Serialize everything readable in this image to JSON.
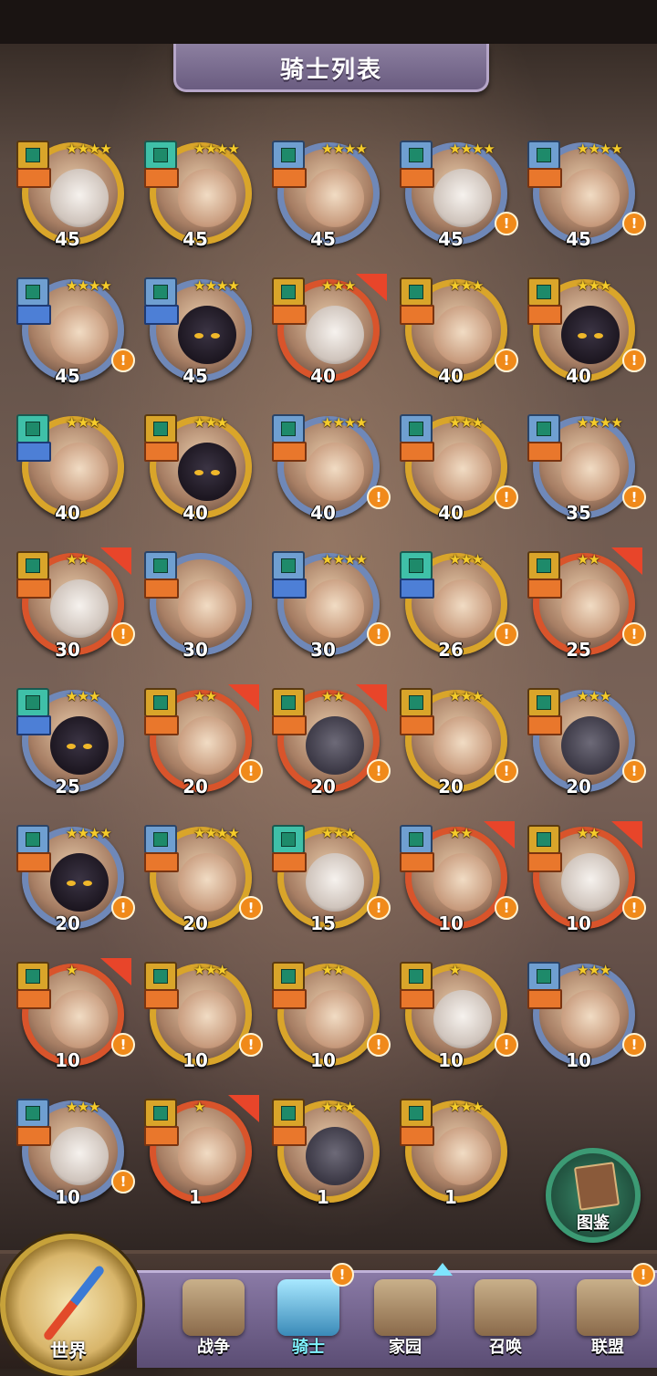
{
  "header": {
    "title": "骑士列表"
  },
  "knights": [
    {
      "level": "45",
      "stars": "★★★★",
      "ring": "",
      "badge": "",
      "role": "",
      "face": "cat",
      "alert": false,
      "corner": false
    },
    {
      "level": "45",
      "stars": "★★★★",
      "ring": "",
      "badge": "green",
      "role": "",
      "face": "",
      "alert": false,
      "corner": false
    },
    {
      "level": "45",
      "stars": "★★★★",
      "ring": "blue",
      "badge": "blue",
      "role": "",
      "face": "",
      "alert": false,
      "corner": false
    },
    {
      "level": "45",
      "stars": "★★★★",
      "ring": "blue",
      "badge": "blue",
      "role": "",
      "face": "cat",
      "alert": true,
      "corner": false
    },
    {
      "level": "45",
      "stars": "★★★★",
      "ring": "blue",
      "badge": "blue",
      "role": "",
      "face": "",
      "alert": true,
      "corner": false
    },
    {
      "level": "45",
      "stars": "★★★★",
      "ring": "blue",
      "badge": "blue",
      "role": "blue",
      "face": "",
      "alert": true,
      "corner": false
    },
    {
      "level": "45",
      "stars": "★★★★",
      "ring": "blue",
      "badge": "blue",
      "role": "blue",
      "face": "dark",
      "alert": false,
      "corner": false
    },
    {
      "level": "40",
      "stars": "★★★",
      "ring": "red",
      "badge": "",
      "role": "",
      "face": "cat",
      "alert": false,
      "corner": true
    },
    {
      "level": "40",
      "stars": "★★★",
      "ring": "",
      "badge": "",
      "role": "",
      "face": "",
      "alert": true,
      "corner": false
    },
    {
      "level": "40",
      "stars": "★★★",
      "ring": "",
      "badge": "",
      "role": "",
      "face": "dark",
      "alert": true,
      "corner": false
    },
    {
      "level": "40",
      "stars": "★★★",
      "ring": "",
      "badge": "green",
      "role": "blue",
      "face": "",
      "alert": false,
      "corner": false
    },
    {
      "level": "40",
      "stars": "★★★",
      "ring": "",
      "badge": "",
      "role": "",
      "face": "dark",
      "alert": false,
      "corner": false
    },
    {
      "level": "40",
      "stars": "★★★★",
      "ring": "blue",
      "badge": "blue",
      "role": "",
      "face": "",
      "alert": true,
      "corner": false
    },
    {
      "level": "40",
      "stars": "★★★",
      "ring": "",
      "badge": "blue",
      "role": "",
      "face": "",
      "alert": true,
      "corner": false
    },
    {
      "level": "35",
      "stars": "★★★★",
      "ring": "blue",
      "badge": "blue",
      "role": "",
      "face": "",
      "alert": true,
      "corner": false
    },
    {
      "level": "30",
      "stars": "★★",
      "ring": "red",
      "badge": "",
      "role": "",
      "face": "cat",
      "alert": true,
      "corner": true
    },
    {
      "level": "30",
      "stars": "",
      "ring": "blue",
      "badge": "blue",
      "role": "",
      "face": "",
      "alert": false,
      "corner": false
    },
    {
      "level": "30",
      "stars": "★★★★",
      "ring": "blue",
      "badge": "blue",
      "role": "blue",
      "face": "",
      "alert": true,
      "corner": false
    },
    {
      "level": "26",
      "stars": "★★★",
      "ring": "",
      "badge": "green",
      "role": "blue",
      "face": "",
      "alert": true,
      "corner": false
    },
    {
      "level": "25",
      "stars": "★★",
      "ring": "red",
      "badge": "",
      "role": "",
      "face": "",
      "alert": true,
      "corner": true
    },
    {
      "level": "25",
      "stars": "★★★",
      "ring": "blue",
      "badge": "green",
      "role": "blue",
      "face": "dark",
      "alert": false,
      "corner": false
    },
    {
      "level": "20",
      "stars": "★★",
      "ring": "red",
      "badge": "",
      "role": "",
      "face": "",
      "alert": true,
      "corner": true
    },
    {
      "level": "20",
      "stars": "★★",
      "ring": "red",
      "badge": "",
      "role": "",
      "face": "beast",
      "alert": true,
      "corner": true
    },
    {
      "level": "20",
      "stars": "★★★",
      "ring": "",
      "badge": "",
      "role": "",
      "face": "",
      "alert": true,
      "corner": false
    },
    {
      "level": "20",
      "stars": "★★★",
      "ring": "blue",
      "badge": "",
      "role": "",
      "face": "beast",
      "alert": true,
      "corner": false
    },
    {
      "level": "20",
      "stars": "★★★★",
      "ring": "blue",
      "badge": "blue",
      "role": "",
      "face": "dark",
      "alert": true,
      "corner": false
    },
    {
      "level": "20",
      "stars": "★★★★",
      "ring": "",
      "badge": "blue",
      "role": "",
      "face": "",
      "alert": true,
      "corner": false
    },
    {
      "level": "15",
      "stars": "★★★",
      "ring": "",
      "badge": "green",
      "role": "",
      "face": "cat",
      "alert": true,
      "corner": false
    },
    {
      "level": "10",
      "stars": "★★",
      "ring": "red",
      "badge": "blue",
      "role": "",
      "face": "",
      "alert": true,
      "corner": true
    },
    {
      "level": "10",
      "stars": "★★",
      "ring": "red",
      "badge": "",
      "role": "",
      "face": "cat",
      "alert": true,
      "corner": true
    },
    {
      "level": "10",
      "stars": "★",
      "ring": "red",
      "badge": "",
      "role": "",
      "face": "",
      "alert": true,
      "corner": true
    },
    {
      "level": "10",
      "stars": "★★★",
      "ring": "",
      "badge": "",
      "role": "",
      "face": "",
      "alert": true,
      "corner": false
    },
    {
      "level": "10",
      "stars": "★★",
      "ring": "",
      "badge": "",
      "role": "",
      "face": "",
      "alert": true,
      "corner": false
    },
    {
      "level": "10",
      "stars": "★",
      "ring": "",
      "badge": "",
      "role": "",
      "face": "cat",
      "alert": true,
      "corner": false
    },
    {
      "level": "10",
      "stars": "★★★",
      "ring": "blue",
      "badge": "blue",
      "role": "",
      "face": "",
      "alert": true,
      "corner": false
    },
    {
      "level": "10",
      "stars": "★★★",
      "ring": "blue",
      "badge": "blue",
      "role": "",
      "face": "cat",
      "alert": true,
      "corner": false
    },
    {
      "level": "1",
      "stars": "★",
      "ring": "red",
      "badge": "",
      "role": "",
      "face": "",
      "alert": false,
      "corner": true
    },
    {
      "level": "1",
      "stars": "★★★",
      "ring": "",
      "badge": "",
      "role": "",
      "face": "beast",
      "alert": false,
      "corner": false
    },
    {
      "level": "1",
      "stars": "★★★",
      "ring": "",
      "badge": "",
      "role": "",
      "face": "",
      "alert": false,
      "corner": false
    }
  ],
  "codex": {
    "label": "图鉴",
    "icon": "book-icon"
  },
  "nav": {
    "world": "世界",
    "items": [
      {
        "label": "战争",
        "icon": "map-icon",
        "active": false,
        "alert": false
      },
      {
        "label": "骑士",
        "icon": "knight-icon",
        "active": true,
        "alert": true
      },
      {
        "label": "家园",
        "icon": "house-icon",
        "active": false,
        "alert": false
      },
      {
        "label": "召唤",
        "icon": "train-icon",
        "active": false,
        "alert": false
      },
      {
        "label": "联盟",
        "icon": "alliance-icon",
        "active": false,
        "alert": true
      }
    ]
  },
  "alert_mark": "!"
}
